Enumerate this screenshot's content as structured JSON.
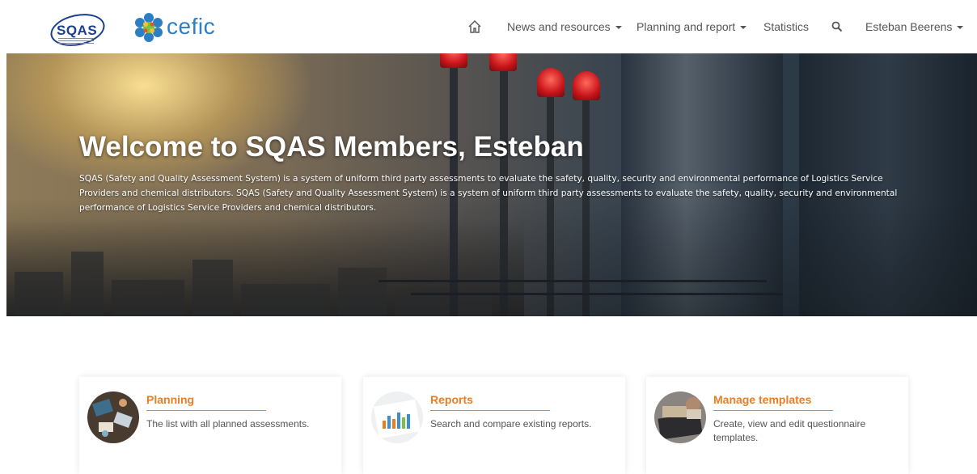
{
  "header": {
    "logo_sqas": "SQAS",
    "logo_cefic": "cefic",
    "nav": {
      "home_icon": "home-icon",
      "news": "News and resources",
      "planning": "Planning and report",
      "statistics": "Statistics",
      "search_icon": "search-icon",
      "user": "Esteban Beerens"
    }
  },
  "hero": {
    "title": "Welcome to SQAS Members, Esteban",
    "text": "SQAS (Safety and Quality Assessment System) is a system of uniform third party assessments to evaluate the safety, quality, security and environmental performance of Logistics Service Providers and chemical distributors. SQAS (Safety and Quality Assessment System) is a system of uniform third party assessments to evaluate the safety, quality, security and environmental performance of Logistics Service Providers and chemical distributors."
  },
  "cards": [
    {
      "title": "Planning",
      "description": "The list with all planned assessments."
    },
    {
      "title": "Reports",
      "description": "Search and compare existing reports."
    },
    {
      "title": "Manage templates",
      "description": "Create, view and edit questionnaire templates."
    }
  ],
  "colors": {
    "accent": "#ee7d1f",
    "sqas_blue": "#1b3f8c",
    "cefic_blue": "#2d7fc4",
    "nav_text": "#555555"
  }
}
